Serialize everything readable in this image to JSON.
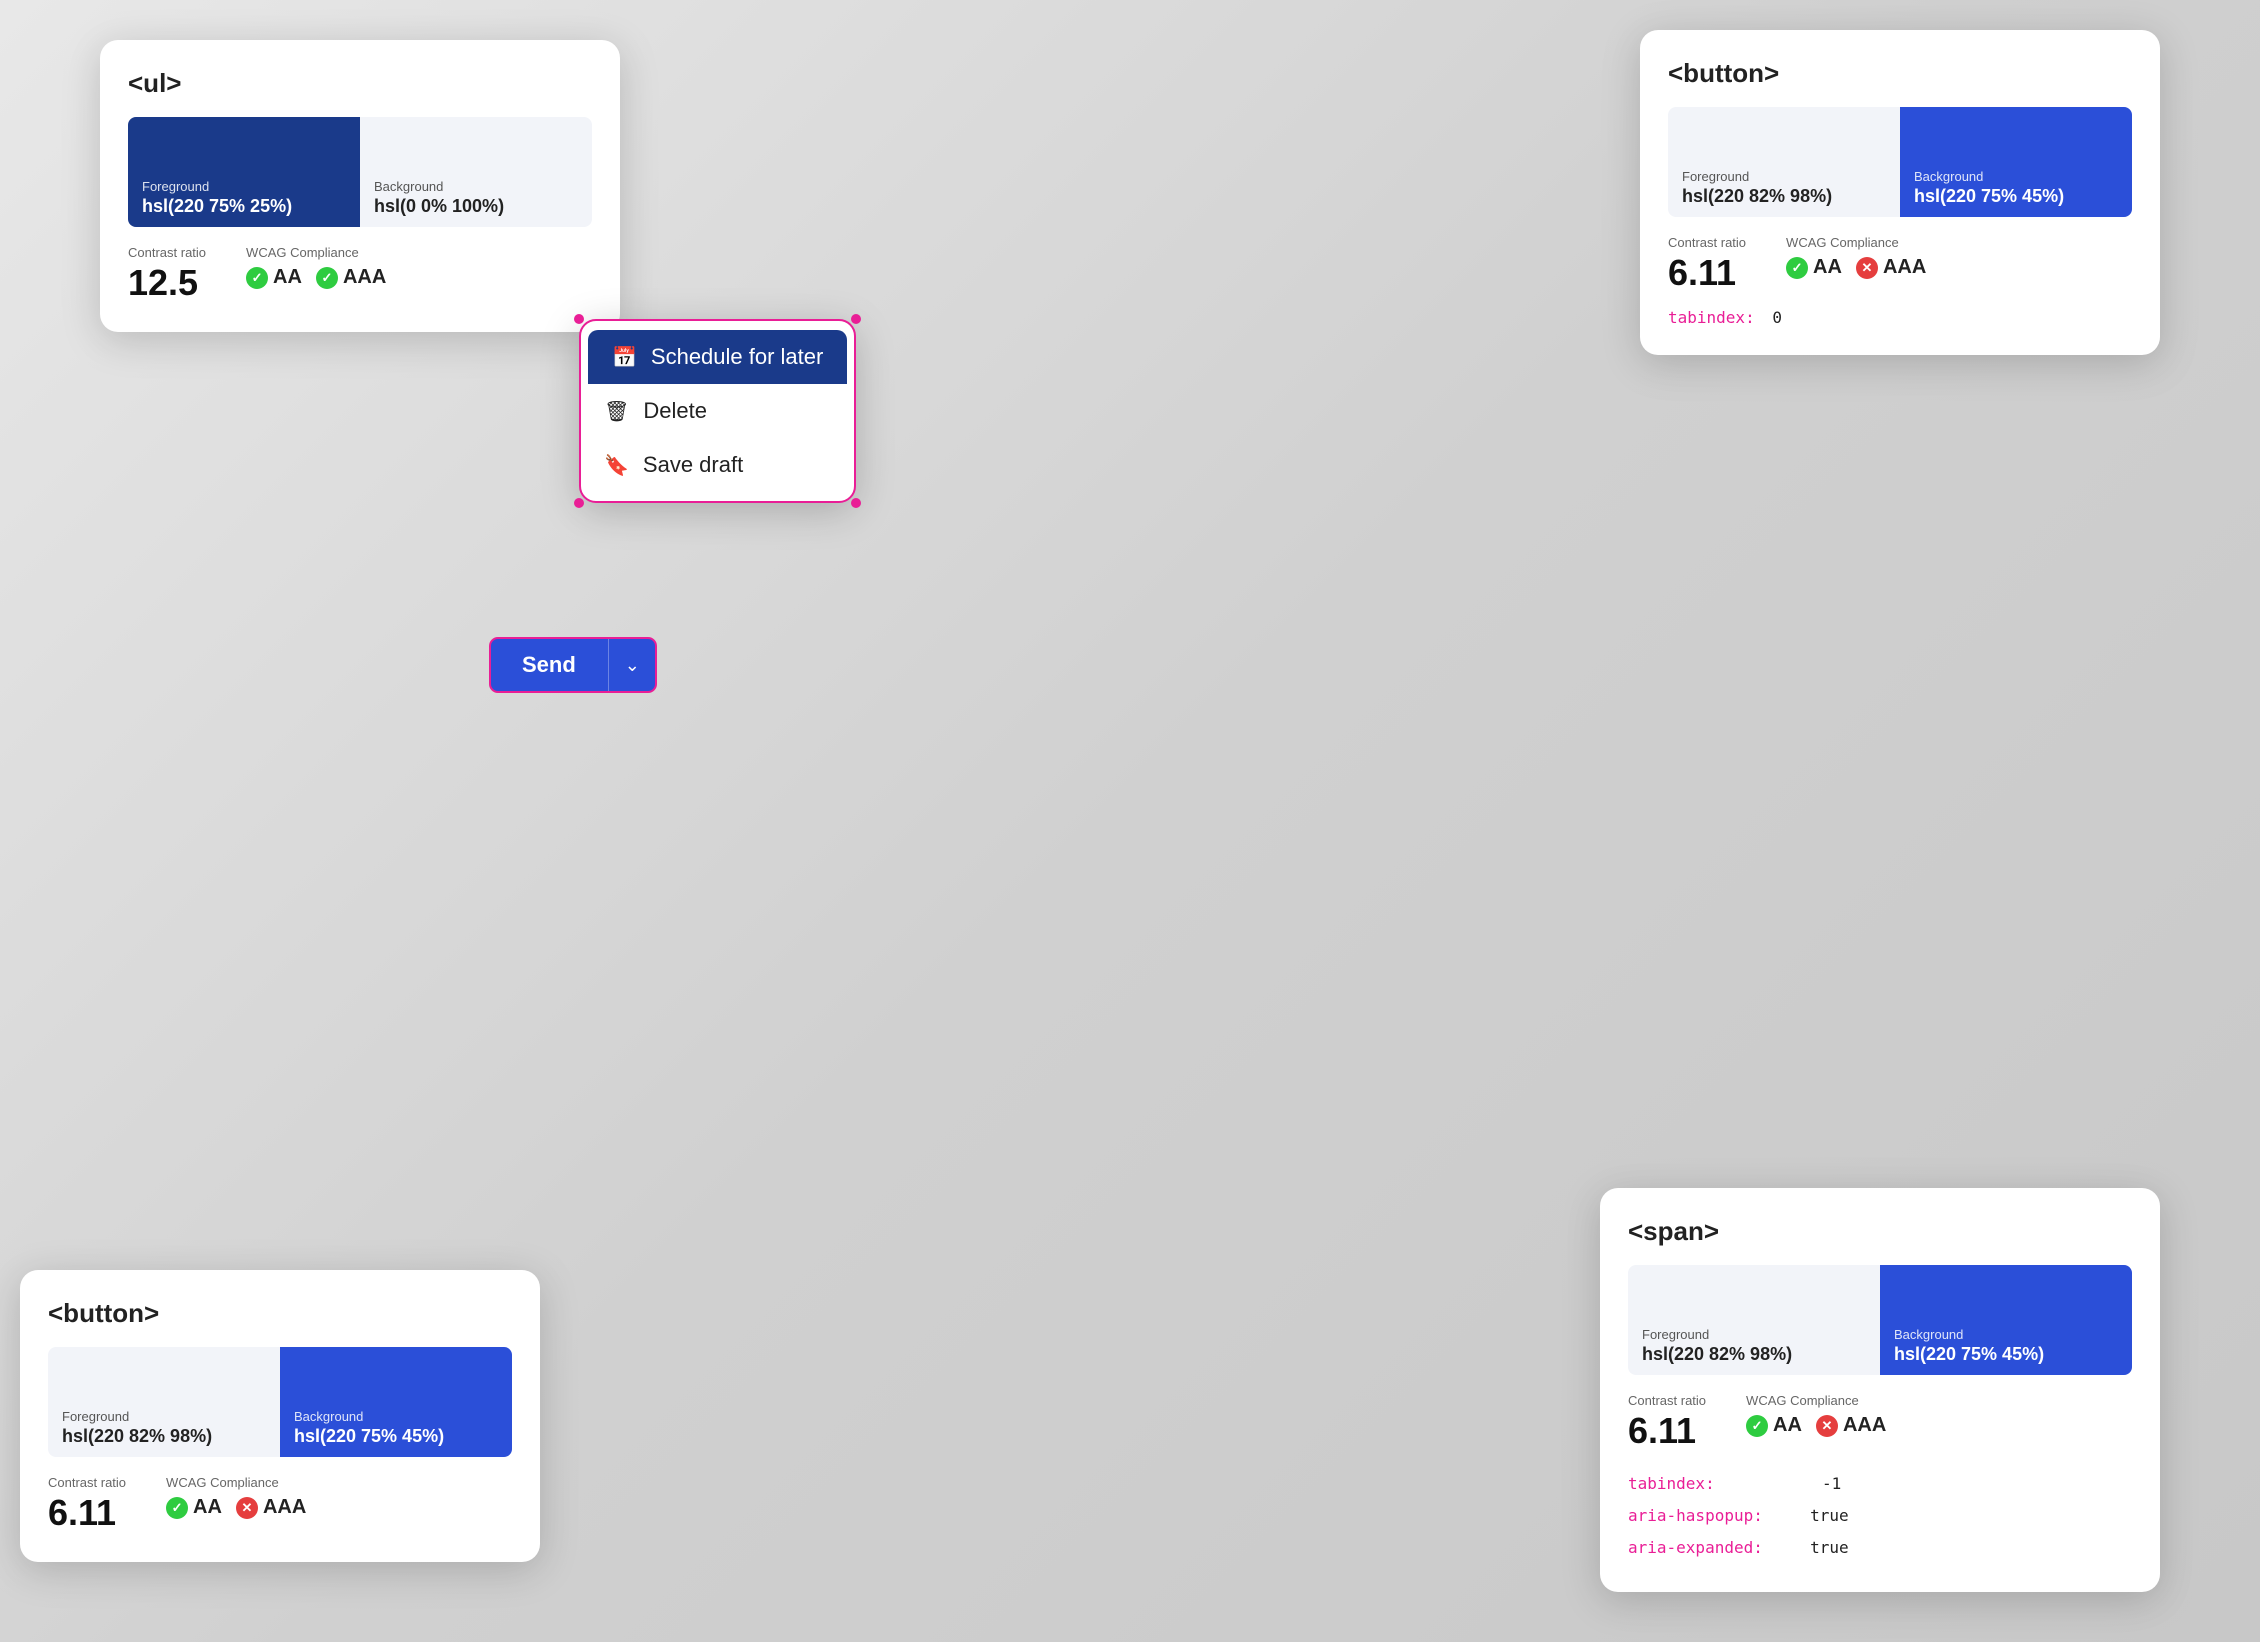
{
  "card_ul": {
    "title": "<ul>",
    "foreground_label": "Foreground",
    "foreground_value": "hsl(220 75% 25%)",
    "background_label": "Background",
    "background_value": "hsl(0 0% 100%)",
    "contrast_label": "Contrast ratio",
    "contrast_value": "12.5",
    "wcag_label": "WCAG Compliance",
    "aa_label": "AA",
    "aaa_label": "AAA",
    "aa_pass": true,
    "aaa_pass": true,
    "fg_color": "#1a3a8a",
    "bg_color": "#ffffff"
  },
  "card_button_top": {
    "title": "<button>",
    "foreground_label": "Foreground",
    "foreground_value": "hsl(220 82% 98%)",
    "background_label": "Background",
    "background_value": "hsl(220 75% 45%)",
    "contrast_label": "Contrast ratio",
    "contrast_value": "6.11",
    "wcag_label": "WCAG Compliance",
    "aa_label": "AA",
    "aaa_label": "AAA",
    "aa_pass": true,
    "aaa_pass": false,
    "tabindex_label": "tabindex:",
    "tabindex_value": "0",
    "fg_color": "#f0f4ff",
    "bg_color": "#2b4fd8"
  },
  "card_button_bottom": {
    "title": "<button>",
    "foreground_label": "Foreground",
    "foreground_value": "hsl(220 82% 98%)",
    "background_label": "Background",
    "background_value": "hsl(220 75% 45%)",
    "contrast_label": "Contrast ratio",
    "contrast_value": "6.11",
    "wcag_label": "WCAG Compliance",
    "aa_label": "AA",
    "aaa_label": "AAA",
    "aa_pass": true,
    "aaa_pass": false,
    "fg_color": "#f0f4ff",
    "bg_color": "#2b4fd8"
  },
  "card_span": {
    "title": "<span>",
    "foreground_label": "Foreground",
    "foreground_value": "hsl(220 82% 98%)",
    "background_label": "Background",
    "background_value": "hsl(220 75% 45%)",
    "contrast_label": "Contrast ratio",
    "contrast_value": "6.11",
    "wcag_label": "WCAG Compliance",
    "aa_label": "AA",
    "aaa_label": "AAA",
    "aa_pass": true,
    "aaa_pass": false,
    "tabindex_label": "tabindex:",
    "tabindex_value": "-1",
    "aria_haspopup_label": "aria-haspopup:",
    "aria_haspopup_value": "true",
    "aria_expanded_label": "aria-expanded:",
    "aria_expanded_value": "true",
    "fg_color": "#f0f4ff",
    "bg_color": "#2b4fd8"
  },
  "dropdown": {
    "schedule_label": "Schedule for later",
    "delete_label": "Delete",
    "save_draft_label": "Save draft"
  },
  "send_button": {
    "send_label": "Send"
  }
}
